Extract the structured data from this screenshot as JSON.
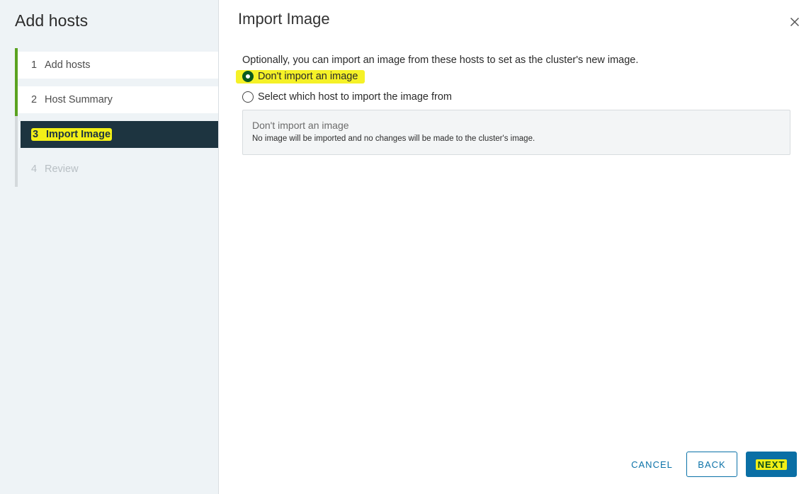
{
  "sidebar": {
    "title": "Add hosts",
    "steps": [
      {
        "num": "1",
        "label": "Add hosts",
        "state": "done"
      },
      {
        "num": "2",
        "label": "Host Summary",
        "state": "done"
      },
      {
        "num": "3",
        "label": "Import Image",
        "state": "active"
      },
      {
        "num": "4",
        "label": "Review",
        "state": "future"
      }
    ]
  },
  "main": {
    "title": "Import Image",
    "intro": "Optionally, you can import an image from these hosts to set as the cluster's new image.",
    "options": [
      {
        "label": "Don't import an image",
        "checked": true
      },
      {
        "label": "Select which host to import the image from",
        "checked": false
      }
    ],
    "info": {
      "title": "Don't import an image",
      "description": "No image will be imported and no changes will be made to the cluster's image."
    }
  },
  "footer": {
    "cancel_label": "CANCEL",
    "back_label": "BACK",
    "next_label": "NEXT"
  },
  "colors": {
    "accent": "#0a6fa5",
    "progress": "#5aa220",
    "active_step_bg": "#1d3440",
    "highlight": "#f2ef17"
  },
  "icons": {
    "close": "close-icon"
  }
}
